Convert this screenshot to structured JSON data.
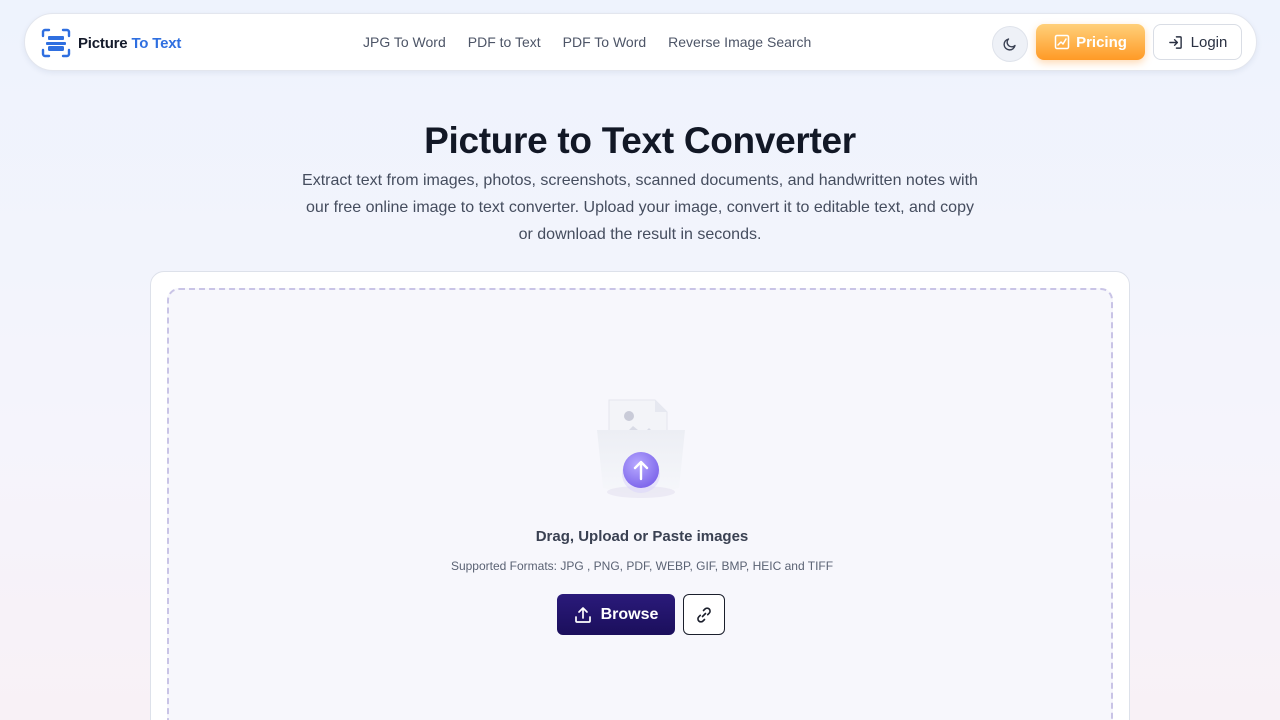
{
  "header": {
    "logo": {
      "text_part1": "Picture",
      "text_part2": "To Text",
      "icon": "scan-icon"
    },
    "nav": [
      {
        "label": "JPG To Word"
      },
      {
        "label": "PDF to Text"
      },
      {
        "label": "PDF To Word"
      },
      {
        "label": "Reverse Image Search"
      }
    ],
    "theme_toggle_icon": "moon-icon",
    "pricing": {
      "label": "Pricing",
      "icon": "chart-icon"
    },
    "login": {
      "label": "Login",
      "icon": "login-icon"
    }
  },
  "hero": {
    "title": "Picture to Text Converter",
    "description": "Extract text from images, photos, screenshots, scanned documents, and handwritten notes with our free online image to text converter. Upload your image, convert it to editable text, and copy or download the result in seconds."
  },
  "upload": {
    "illustration_icon": "image-upload-icon",
    "drag_text": "Drag, Upload or Paste images",
    "formats": "Supported Formats: JPG , PNG, PDF, WEBP, GIF, BMP, HEIC and TIFF",
    "browse_label": "Browse",
    "browse_icon": "upload-icon",
    "link_icon": "link-icon"
  },
  "colors": {
    "brand_blue": "#2f6fe0",
    "pricing_orange": "#ff9a26",
    "browse_purple": "#1b0f5c",
    "upload_accent": "#8c7cf0"
  }
}
